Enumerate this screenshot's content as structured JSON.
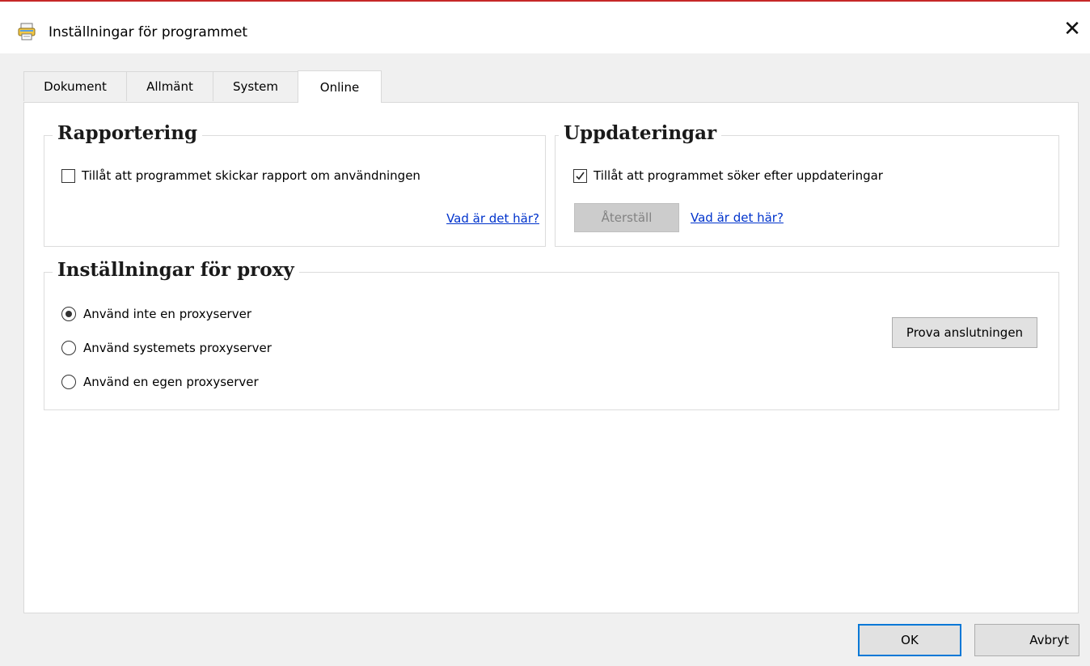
{
  "window": {
    "title": "Inställningar för programmet",
    "icon": "printer-app-icon",
    "close_glyph": "✕"
  },
  "tabs": [
    {
      "label": "Dokument",
      "active": false
    },
    {
      "label": "Allmänt",
      "active": false
    },
    {
      "label": "System",
      "active": false
    },
    {
      "label": "Online",
      "active": true
    }
  ],
  "reporting": {
    "title": "Rapportering",
    "checkbox_label": "Tillåt att programmet skickar rapport om användningen",
    "checked": false,
    "link": "Vad är det här?"
  },
  "updates": {
    "title": "Uppdateringar",
    "checkbox_label": "Tillåt att programmet söker efter uppdateringar",
    "checked": true,
    "reset_button": "Återställ",
    "link": "Vad är det här?"
  },
  "proxy": {
    "title": "Inställningar för proxy",
    "options": [
      {
        "label": "Använd inte en proxyserver",
        "selected": true
      },
      {
        "label": "Använd systemets proxyserver",
        "selected": false
      },
      {
        "label": "Använd en egen proxyserver",
        "selected": false
      }
    ],
    "test_button": "Prova anslutningen"
  },
  "footer": {
    "ok": "OK",
    "cancel": "Avbryt"
  },
  "colors": {
    "accent": "#0078d7",
    "link": "#0033cc",
    "top_border": "#c62828"
  }
}
